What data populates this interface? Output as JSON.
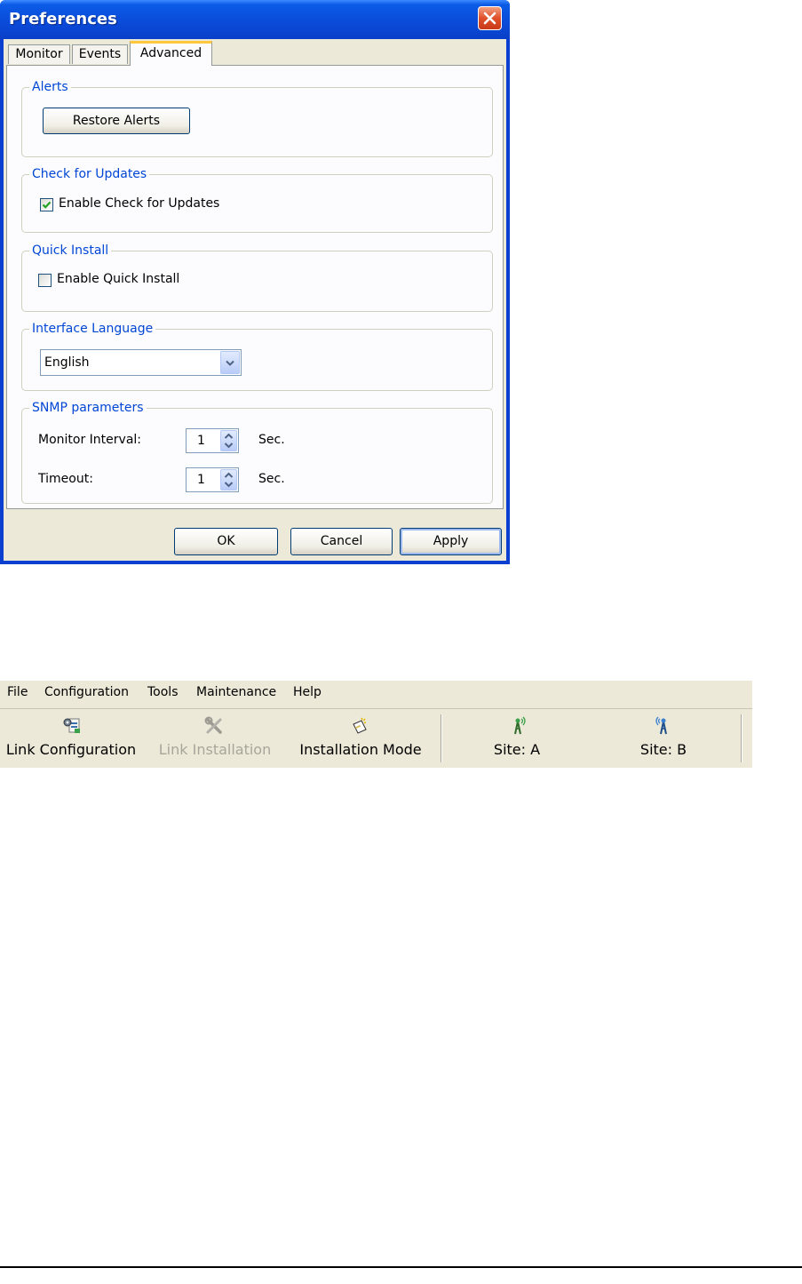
{
  "dialog": {
    "title": "Preferences",
    "tabs": [
      {
        "label": "Monitor",
        "active": false
      },
      {
        "label": "Events",
        "active": false
      },
      {
        "label": "Advanced",
        "active": true
      }
    ],
    "alerts": {
      "group_label": "Alerts",
      "restore_button": "Restore Alerts"
    },
    "updates": {
      "group_label": "Check for Updates",
      "checkbox_label": "Enable Check for Updates",
      "checked": true
    },
    "quick_install": {
      "group_label": "Quick Install",
      "checkbox_label": "Enable Quick Install",
      "checked": false
    },
    "language": {
      "group_label": "Interface Language",
      "selected": "English"
    },
    "snmp": {
      "group_label": "SNMP parameters",
      "monitor_interval_label": "Monitor Interval:",
      "monitor_interval_value": "1",
      "timeout_label": "Timeout:",
      "timeout_value": "1",
      "unit": "Sec."
    },
    "buttons": {
      "ok": "OK",
      "cancel": "Cancel",
      "apply": "Apply"
    }
  },
  "app": {
    "menu": [
      "File",
      "Configuration",
      "Tools",
      "Maintenance",
      "Help"
    ],
    "toolbar": {
      "link_configuration": "Link Configuration",
      "link_installation": "Link Installation",
      "installation_mode": "Installation Mode",
      "site_a": "Site: A",
      "site_b": "Site: B"
    }
  },
  "colors": {
    "title_bar": "#0a4ad8",
    "group_label": "#0046d5",
    "dialog_face": "#ece9d8",
    "disabled_text": "#a8a69a"
  }
}
